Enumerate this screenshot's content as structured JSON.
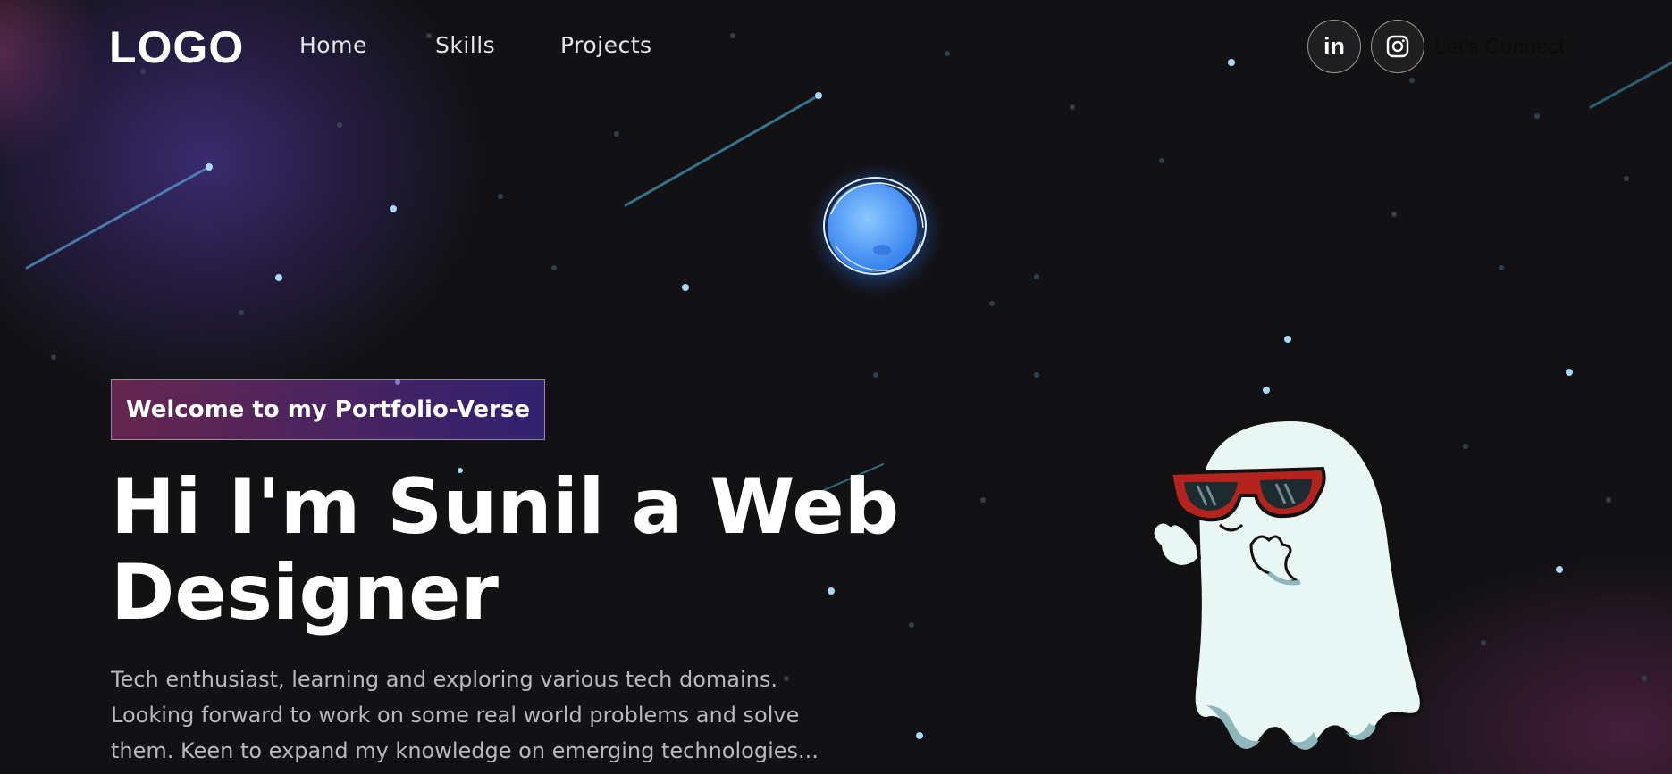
{
  "navbar": {
    "logo": "LOGO",
    "links": [
      "Home",
      "Skills",
      "Projects"
    ],
    "social": [
      {
        "name": "linkedin-icon",
        "label": "in"
      },
      {
        "name": "instagram-icon"
      }
    ],
    "connect_label": "Let's Connect"
  },
  "hero": {
    "tagline": "Welcome to my Portfolio-Verse",
    "headline_line1": "Hi I'm Sunil a Web",
    "headline_line2": "Designer",
    "description_lines": [
      "Tech enthusiast, learning and exploring various tech domains.",
      "Looking forward to work on some real world problems and solve",
      "them. Keen to expand my knowledge on emerging technologies..."
    ]
  },
  "colors": {
    "background": "#121214",
    "tagline_gradient_start": "#aa367c",
    "tagline_gradient_end": "#4a2fbd",
    "orb_blue": "#3b8cff",
    "ghost_body": "#e8f6f4",
    "sunglasses": "#b5231f"
  }
}
